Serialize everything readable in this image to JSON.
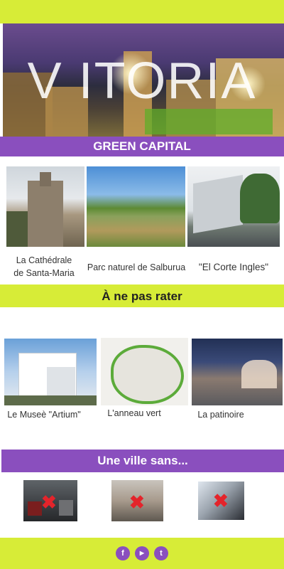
{
  "hero": {
    "title": "V ITORIA"
  },
  "banner": {
    "label": "GREEN CAPITAL"
  },
  "places": [
    {
      "caption_line1": "La Cathédrale",
      "caption_line2": "de Santa-Maria"
    },
    {
      "caption": "Parc naturel de Salburua"
    },
    {
      "caption": "\"El Corte Ingles\""
    }
  ],
  "must_see": {
    "title": "À ne pas rater"
  },
  "highlights": [
    {
      "caption": "Le Museè \"Artium\""
    },
    {
      "caption": "L'anneau vert"
    },
    {
      "caption": "La patinoire"
    }
  ],
  "without": {
    "title": "Une ville sans..."
  },
  "footer": {
    "icons": [
      "facebook-icon",
      "youtube-icon",
      "twitter-icon"
    ],
    "glyphs": [
      "f",
      "▶",
      "t"
    ]
  },
  "colors": {
    "lime": "#d7ec37",
    "purple": "#8a4fbe",
    "cross": "#e4242b"
  }
}
